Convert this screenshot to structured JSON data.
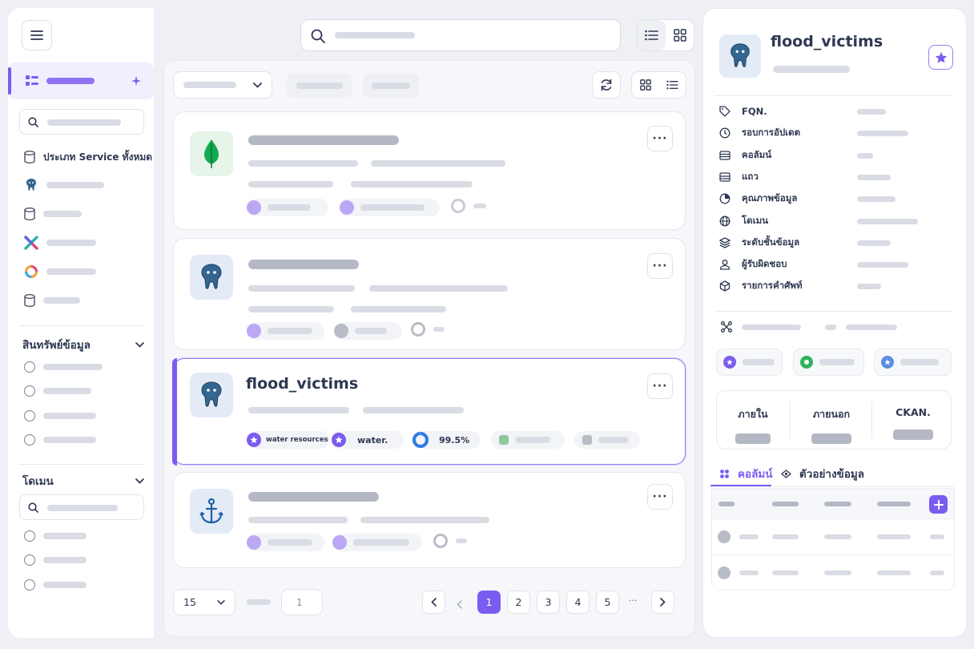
{
  "sidebar": {
    "service_label": "ประเภท Service ทั้งหมด",
    "assets_section": "สินทรัพย์ข้อมูล",
    "domain_section": "โดเมน"
  },
  "results": {
    "selected": {
      "name": "flood_victims",
      "tag1": "water resources",
      "tag2": "water.",
      "quality": "99.5%"
    }
  },
  "pagination": {
    "page_size": "15",
    "page_input": "1",
    "pages": [
      "1",
      "2",
      "3",
      "4",
      "5"
    ],
    "ellipsis": "···"
  },
  "detail": {
    "name": "flood_victims",
    "properties": [
      {
        "label": "FQN.",
        "icon": "tag-icon"
      },
      {
        "label": "รอบการอัปเดต",
        "icon": "clock-icon"
      },
      {
        "label": "คอลัมน์",
        "icon": "table-icon"
      },
      {
        "label": "แถว",
        "icon": "rows-icon"
      },
      {
        "label": "คุณภาพข้อมูล",
        "icon": "pie-chart-icon"
      },
      {
        "label": "โดเมน",
        "icon": "globe-icon"
      },
      {
        "label": "ระดับชั้นข้อมูล",
        "icon": "layers-icon"
      },
      {
        "label": "ผู้รับผิดชอบ",
        "icon": "user-icon"
      },
      {
        "label": "รายการคำศัพท์",
        "icon": "cube-icon"
      }
    ],
    "stats": [
      "ภายใน",
      "ภายนอก",
      "CKAN."
    ],
    "tabs": {
      "columns": "คอลัมน์",
      "sample": "ตัวอย่างข้อมูล"
    }
  },
  "colors": {
    "accent": "#7b5cf0",
    "text": "#2f3852",
    "placeholder": "#d9dce4"
  }
}
